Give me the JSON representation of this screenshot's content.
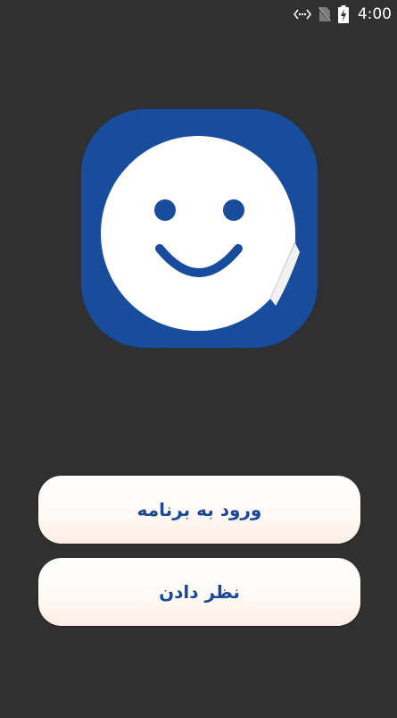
{
  "status_bar": {
    "time": "4:00",
    "icons": [
      "data-transfer-icon",
      "no-sim-icon",
      "battery-charging-icon"
    ]
  },
  "logo": {
    "icon": "smiley-sticker-icon",
    "bg_color": "#184d9e",
    "face_color": "#ffffff"
  },
  "buttons": {
    "enter_label": "ورود به برنامه",
    "comment_label": "نظر دادن"
  },
  "colors": {
    "background": "#303030",
    "accent": "#1a4898"
  }
}
